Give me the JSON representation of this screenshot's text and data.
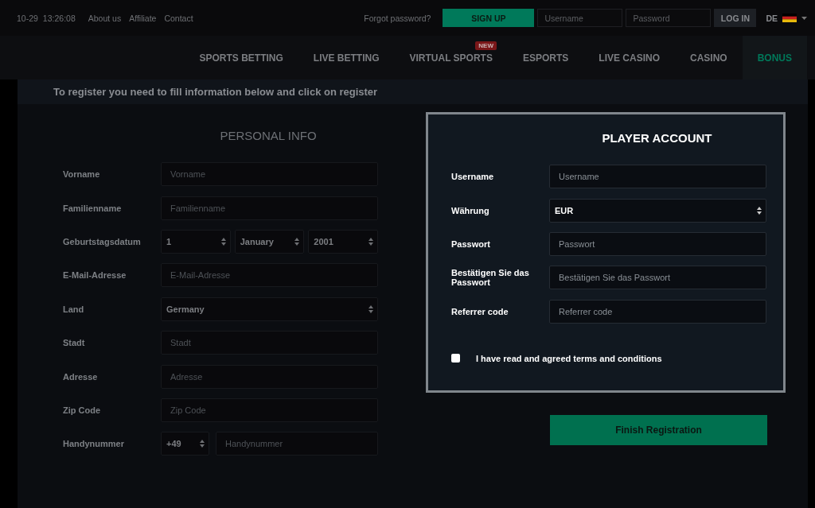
{
  "top_bar": {
    "date": "10-29",
    "time": "13:26:08",
    "links": [
      "About us",
      "Affiliate",
      "Contact"
    ],
    "forgot_password": "Forgot password?",
    "sign_up": "SIGN UP",
    "username": {
      "placeholder": "Username"
    },
    "password": {
      "placeholder": "Password"
    },
    "log_in": "LOG IN",
    "language": "DE"
  },
  "nav": [
    {
      "label": "SPORTS BETTING",
      "selected": false
    },
    {
      "label": "LIVE BETTING",
      "selected": false
    },
    {
      "label": "VIRTUAL SPORTS",
      "selected": false,
      "badge": "NEW"
    },
    {
      "label": "ESPORTS",
      "selected": false
    },
    {
      "label": "LIVE CASINO",
      "selected": false
    },
    {
      "label": "CASINO",
      "selected": false
    },
    {
      "label": "BONUS",
      "selected": true
    }
  ],
  "banner": "To register you need to fill information below and click on register",
  "personal_info": {
    "title": "PERSONAL INFO",
    "fields": [
      {
        "kind": "text",
        "label": "Vorname",
        "placeholder": "Vorname"
      },
      {
        "kind": "text",
        "label": "Familienname",
        "placeholder": "Familienname"
      },
      {
        "kind": "date",
        "label": "Geburtstagsdatum",
        "day": "1",
        "month": "January",
        "year": "2001"
      },
      {
        "kind": "text",
        "label": "E-Mail-Adresse",
        "placeholder": "E-Mail-Adresse"
      },
      {
        "kind": "select",
        "label": "Land",
        "value": "Germany"
      },
      {
        "kind": "text",
        "label": "Stadt",
        "placeholder": "Stadt"
      },
      {
        "kind": "text",
        "label": "Adresse",
        "placeholder": "Adresse"
      },
      {
        "kind": "text",
        "label": "Zip Code",
        "placeholder": "Zip Code"
      },
      {
        "kind": "phone",
        "label": "Handynummer",
        "code": "+49",
        "placeholder": "Handynummer"
      }
    ]
  },
  "player_account": {
    "title": "PLAYER ACCOUNT",
    "fields": [
      {
        "kind": "text",
        "label": "Username",
        "placeholder": "Username"
      },
      {
        "kind": "select",
        "label": "Währung",
        "value": "EUR"
      },
      {
        "kind": "text",
        "label": "Passwort",
        "placeholder": "Passwort"
      },
      {
        "kind": "text",
        "label": "Bestätigen Sie das Passwort",
        "placeholder": "Bestätigen Sie das Passwort"
      },
      {
        "kind": "text",
        "label": "Referrer code",
        "placeholder": "Referrer code"
      }
    ],
    "terms": {
      "label": "I have read and agreed terms and conditions",
      "checked": false
    }
  },
  "finish_button": "Finish Registration"
}
